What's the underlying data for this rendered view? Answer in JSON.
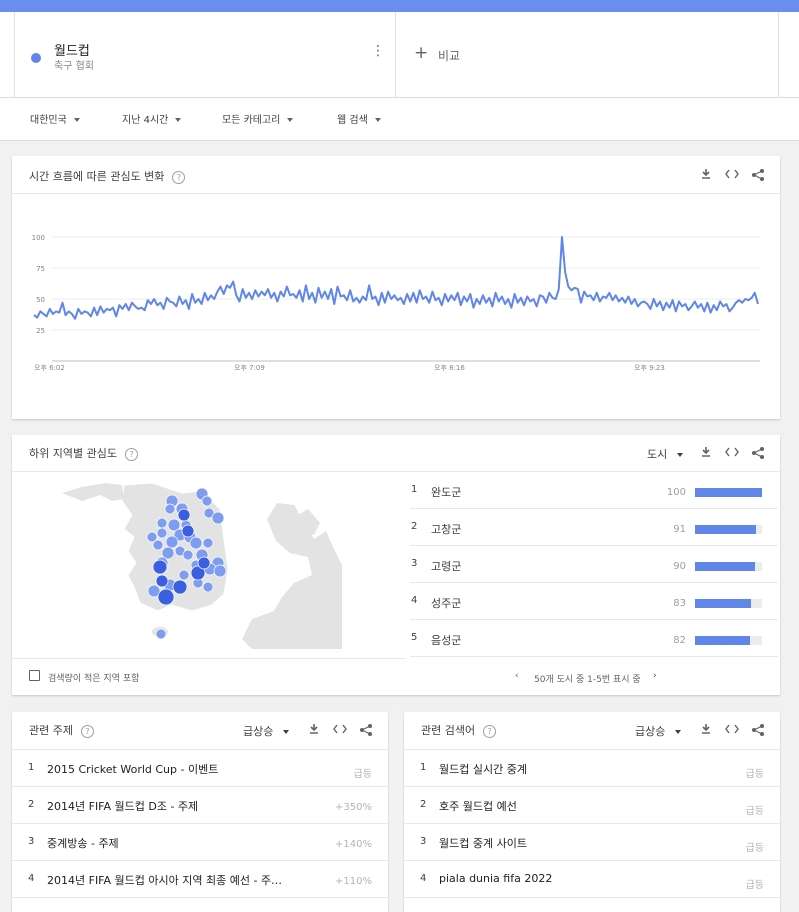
{
  "term": {
    "name": "월드컵",
    "category": "축구 협회",
    "color": "#5f86e8"
  },
  "compare": {
    "label": "비교"
  },
  "filters": [
    {
      "label": "대한민국"
    },
    {
      "label": "지난 4시간"
    },
    {
      "label": "모든 카테고리"
    },
    {
      "label": "웹 검색"
    }
  ],
  "interest_over_time": {
    "title": "시간 흐름에 따른 관심도 변화",
    "help": "?",
    "tools": [
      "download-icon",
      "embed-icon",
      "share-icon"
    ]
  },
  "chart_data": {
    "type": "line",
    "title": "",
    "xlabel": "",
    "ylabel": "",
    "ylim": [
      0,
      100
    ],
    "yticks": [
      25,
      50,
      75,
      100
    ],
    "xticks": [
      "오후 6:02",
      "오후 7:09",
      "오후 8:16",
      "오후 9:23"
    ],
    "grid": true,
    "color": "#5f86e8",
    "series": [
      {
        "values": [
          37,
          35,
          40,
          38,
          36,
          42,
          38,
          40,
          39,
          47,
          37,
          40,
          38,
          34,
          42,
          38,
          40,
          39,
          36,
          43,
          37,
          44,
          39,
          42,
          41,
          43,
          36,
          45,
          42,
          46,
          41,
          47,
          44,
          42,
          43,
          41,
          49,
          46,
          50,
          45,
          47,
          42,
          51,
          48,
          47,
          44,
          52,
          46,
          49,
          42,
          54,
          47,
          50,
          46,
          55,
          49,
          53,
          50,
          56,
          60,
          54,
          61,
          59,
          64,
          53,
          48,
          58,
          51,
          55,
          50,
          57,
          52,
          56,
          53,
          58,
          51,
          55,
          48,
          56,
          52,
          60,
          53,
          54,
          51,
          57,
          48,
          61,
          50,
          55,
          47,
          59,
          51,
          56,
          50,
          58,
          46,
          60,
          52,
          53,
          49,
          57,
          48,
          51,
          47,
          52,
          49,
          61,
          50,
          52,
          45,
          55,
          47,
          56,
          50,
          53,
          49,
          51,
          46,
          54,
          48,
          55,
          47,
          57,
          50,
          52,
          47,
          56,
          49,
          51,
          45,
          54,
          48,
          53,
          49,
          55,
          45,
          52,
          48,
          54,
          43,
          50,
          46,
          53,
          47,
          51,
          44,
          55,
          48,
          52,
          46,
          50,
          43,
          54,
          47,
          51,
          45,
          52,
          48,
          50,
          44,
          53,
          52,
          47,
          55,
          51,
          50,
          58,
          100,
          72,
          60,
          57,
          59,
          58,
          47,
          56,
          52,
          53,
          49,
          55,
          48,
          52,
          51,
          55,
          49,
          53,
          48,
          51,
          47,
          52,
          46,
          50,
          44,
          47,
          48,
          46,
          42,
          50,
          44,
          48,
          41,
          47,
          43,
          49,
          40,
          48,
          44,
          46,
          41,
          44,
          48,
          43,
          46,
          40,
          47,
          39,
          45,
          41,
          48,
          44,
          46,
          40,
          43,
          47,
          49,
          47,
          50,
          49,
          51,
          55,
          46
        ]
      }
    ]
  },
  "regional": {
    "title": "하위 지역별 관심도",
    "help": "?",
    "resolution": "도시",
    "rows": [
      {
        "rank": "1",
        "name": "완도군",
        "value": 100
      },
      {
        "rank": "2",
        "name": "고창군",
        "value": 91
      },
      {
        "rank": "3",
        "name": "고령군",
        "value": 90
      },
      {
        "rank": "4",
        "name": "성주군",
        "value": 83
      },
      {
        "rank": "5",
        "name": "음성군",
        "value": 82
      }
    ],
    "low_volume_label": "검색량이 적은 지역 포함",
    "pager_label": "50개 도시 중 1-5번 표시 중"
  },
  "related_topics": {
    "title": "관련 주제",
    "help": "?",
    "sort": "급상승",
    "rows": [
      {
        "rank": "1",
        "label": "2015 Cricket World Cup - 이벤트",
        "value": "급등"
      },
      {
        "rank": "2",
        "label": "2014년 FIFA 월드컵 D조 - 주제",
        "value": "+350%"
      },
      {
        "rank": "3",
        "label": "중계방송 - 주제",
        "value": "+140%"
      },
      {
        "rank": "4",
        "label": "2014년 FIFA 월드컵 아시아 지역 최종 예선 - 주…",
        "value": "+110%"
      }
    ]
  },
  "related_queries": {
    "title": "관련 검색어",
    "help": "?",
    "sort": "급상승",
    "rows": [
      {
        "rank": "1",
        "label": "월드컵 실시간 중계",
        "value": "급등"
      },
      {
        "rank": "2",
        "label": "호주 월드컵 예선",
        "value": "급등"
      },
      {
        "rank": "3",
        "label": "월드컵 중계 사이트",
        "value": "급등"
      },
      {
        "rank": "4",
        "label": "piala dunia fifa 2022",
        "value": "급등"
      }
    ]
  }
}
